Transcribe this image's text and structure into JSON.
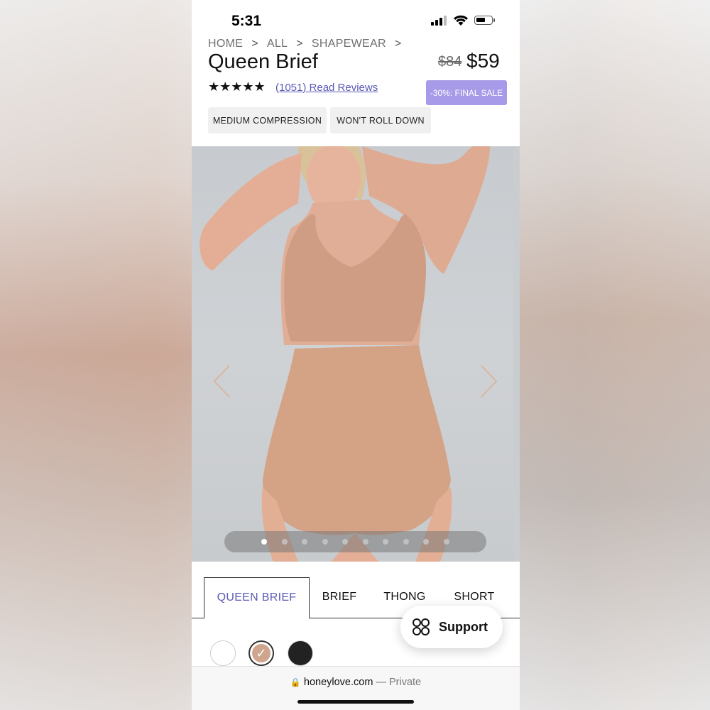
{
  "status_bar": {
    "time": "5:31"
  },
  "breadcrumb": {
    "items": [
      "HOME",
      "ALL",
      "SHAPEWEAR"
    ],
    "separator": ">"
  },
  "product": {
    "title": "Queen Brief",
    "price_old": "$84",
    "price_new": "$59",
    "rating_stars": "★★★★★",
    "rating_value": 4.5,
    "reviews_link": "(1051) Read Reviews",
    "sale_badge": "-30%: FINAL SALE",
    "tags": [
      "MEDIUM COMPRESSION",
      "WON'T ROLL DOWN"
    ]
  },
  "gallery": {
    "prev_icon": "chevron-left-icon",
    "next_icon": "chevron-right-icon",
    "dot_count": 10,
    "active_dot": 1
  },
  "style_tabs": {
    "items": [
      "QUEEN BRIEF",
      "BRIEF",
      "THONG",
      "SHORT"
    ],
    "active": "QUEEN BRIEF",
    "active_color": "#5a59b5"
  },
  "support": {
    "label": "Support",
    "icon": "support-flower-icon"
  },
  "swatches": {
    "colors": [
      "#ffffff",
      "#cfa58e",
      "#222222"
    ],
    "selected": 1
  },
  "browser": {
    "domain": "honeylove.com",
    "privacy": "— Private"
  },
  "colors": {
    "accent": "#5a59b5",
    "badge": "#a79ae8"
  }
}
